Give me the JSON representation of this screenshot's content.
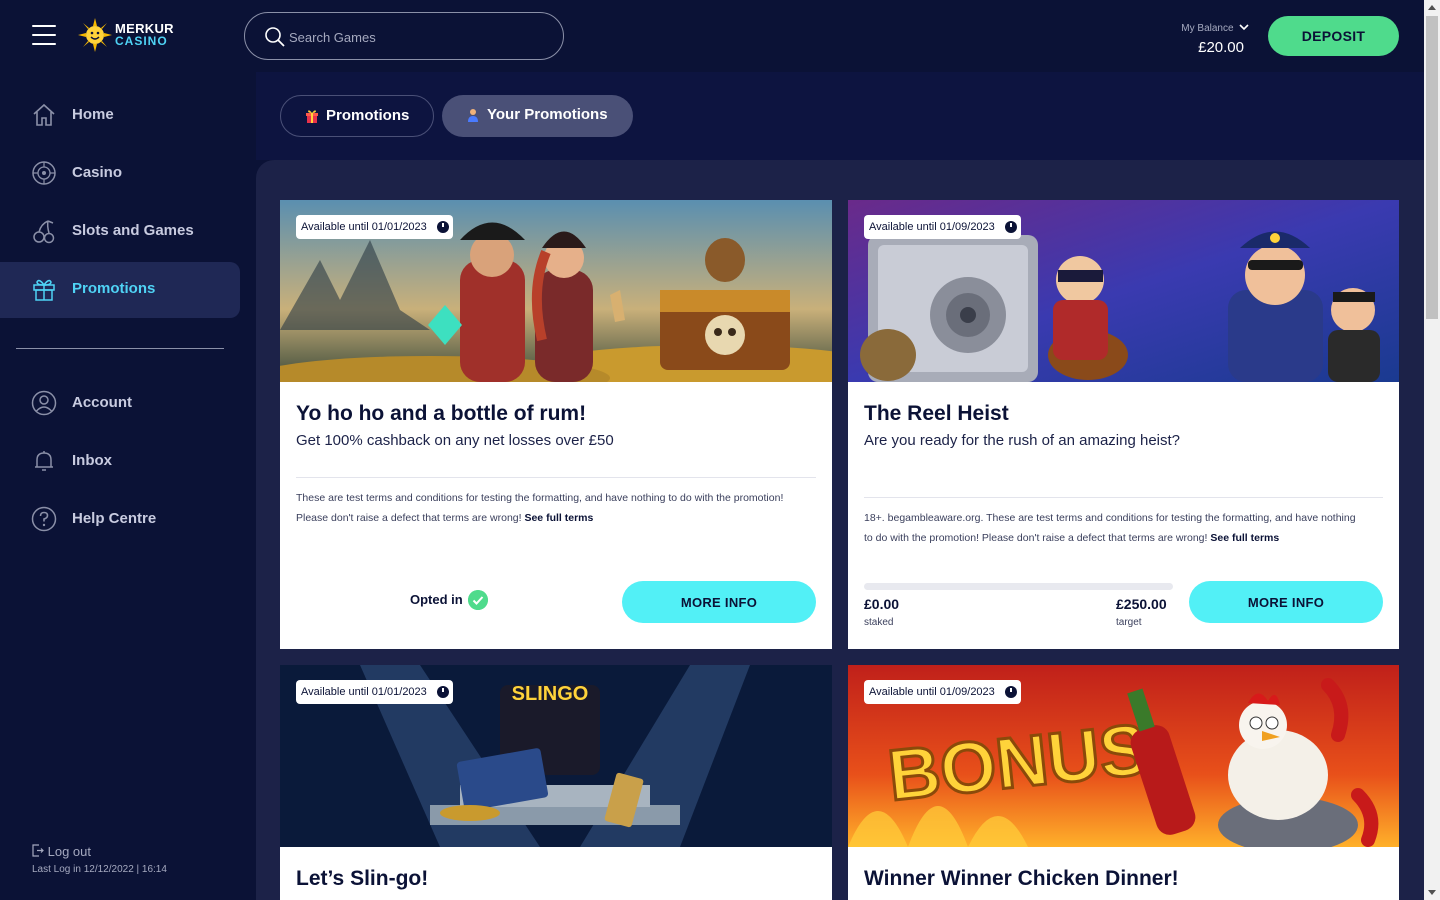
{
  "header": {
    "logo_line1": "MERKUR",
    "logo_line2": "CASINO",
    "search_placeholder": "Search Games",
    "balance_label": "My Balance",
    "balance_amount": "£20.00",
    "deposit_label": "DEPOSIT"
  },
  "sidebar": {
    "items": [
      {
        "label": "Home",
        "icon": "home-icon"
      },
      {
        "label": "Casino",
        "icon": "roulette-icon"
      },
      {
        "label": "Slots and Games",
        "icon": "cherries-icon"
      },
      {
        "label": "Promotions",
        "icon": "gift-icon",
        "active": true
      },
      {
        "label": "Account",
        "icon": "user-icon"
      },
      {
        "label": "Inbox",
        "icon": "bell-icon"
      },
      {
        "label": "Help Centre",
        "icon": "help-icon"
      }
    ],
    "logout_label": "Log out",
    "last_login": "Last Log in 12/12/2022 | 16:14"
  },
  "tabs": [
    {
      "label": "Promotions",
      "icon": "gift-icon"
    },
    {
      "label": "Your Promotions",
      "icon": "person-icon",
      "selected": true
    }
  ],
  "cards": [
    {
      "available": "Available until 01/01/2023",
      "title": "Yo ho ho and a bottle of rum!",
      "subtitle": "Get 100% cashback on any net losses over £50",
      "terms": "These are test terms and conditions for testing the formatting, and have nothing to do with the promotion! Please don't raise a defect that terms are wrong!",
      "terms_link": "See full terms",
      "status": "Opted in",
      "button": "MORE INFO"
    },
    {
      "available": "Available until 01/09/2023",
      "title": "The Reel Heist",
      "subtitle": "Are you ready for the rush of an amazing heist?",
      "terms": "18+. begambleaware.org. These are test terms and conditions for testing the formatting, and have nothing to do with the promotion! Please don't raise a defect that terms are wrong!",
      "terms_link": "See full terms",
      "staked_value": "£0.00",
      "staked_label": "staked",
      "target_value": "£250.00",
      "target_label": "target",
      "progress": 0,
      "button": "MORE INFO"
    },
    {
      "available": "Available until 01/01/2023",
      "title": "Let’s Slin-go!"
    },
    {
      "available": "Available until 01/09/2023",
      "title": "Winner Winner Chicken Dinner!"
    }
  ],
  "colors": {
    "background": "#0b1236",
    "accent_cyan": "#52f0f6",
    "deposit_green": "#4fdb8c",
    "active_nav": "#4fd3f5"
  }
}
